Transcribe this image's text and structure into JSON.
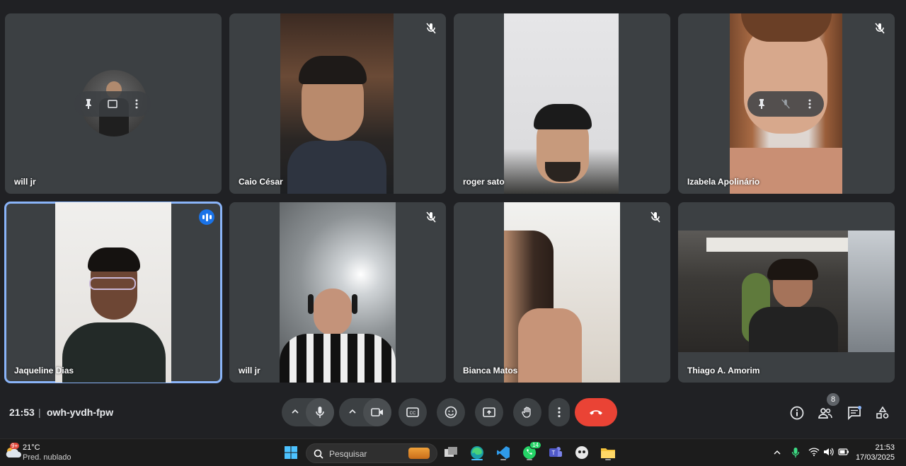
{
  "participants": [
    {
      "name": "will jr"
    },
    {
      "name": "Caio César"
    },
    {
      "name": "roger sato"
    },
    {
      "name": "Izabela Apolinário"
    },
    {
      "name": "Jaqueline Dias"
    },
    {
      "name": "will jr"
    },
    {
      "name": "Bianca Matos"
    },
    {
      "name": "Thiago A. Amorim"
    }
  ],
  "meeting": {
    "time": "21:53",
    "separator": "|",
    "code": "owh-yvdh-fpw"
  },
  "people_count": "8",
  "taskbar": {
    "temperature": "21°C",
    "forecast": "Pred. nublado",
    "weather_badge": "9+",
    "search_placeholder": "Pesquisar",
    "whatsapp_badge": "14",
    "clock_time": "21:53",
    "clock_date": "17/03/2025"
  },
  "colors": {
    "end_call": "#ea4335",
    "active_outline": "#8ab4f8",
    "speaking": "#1a73e8"
  }
}
